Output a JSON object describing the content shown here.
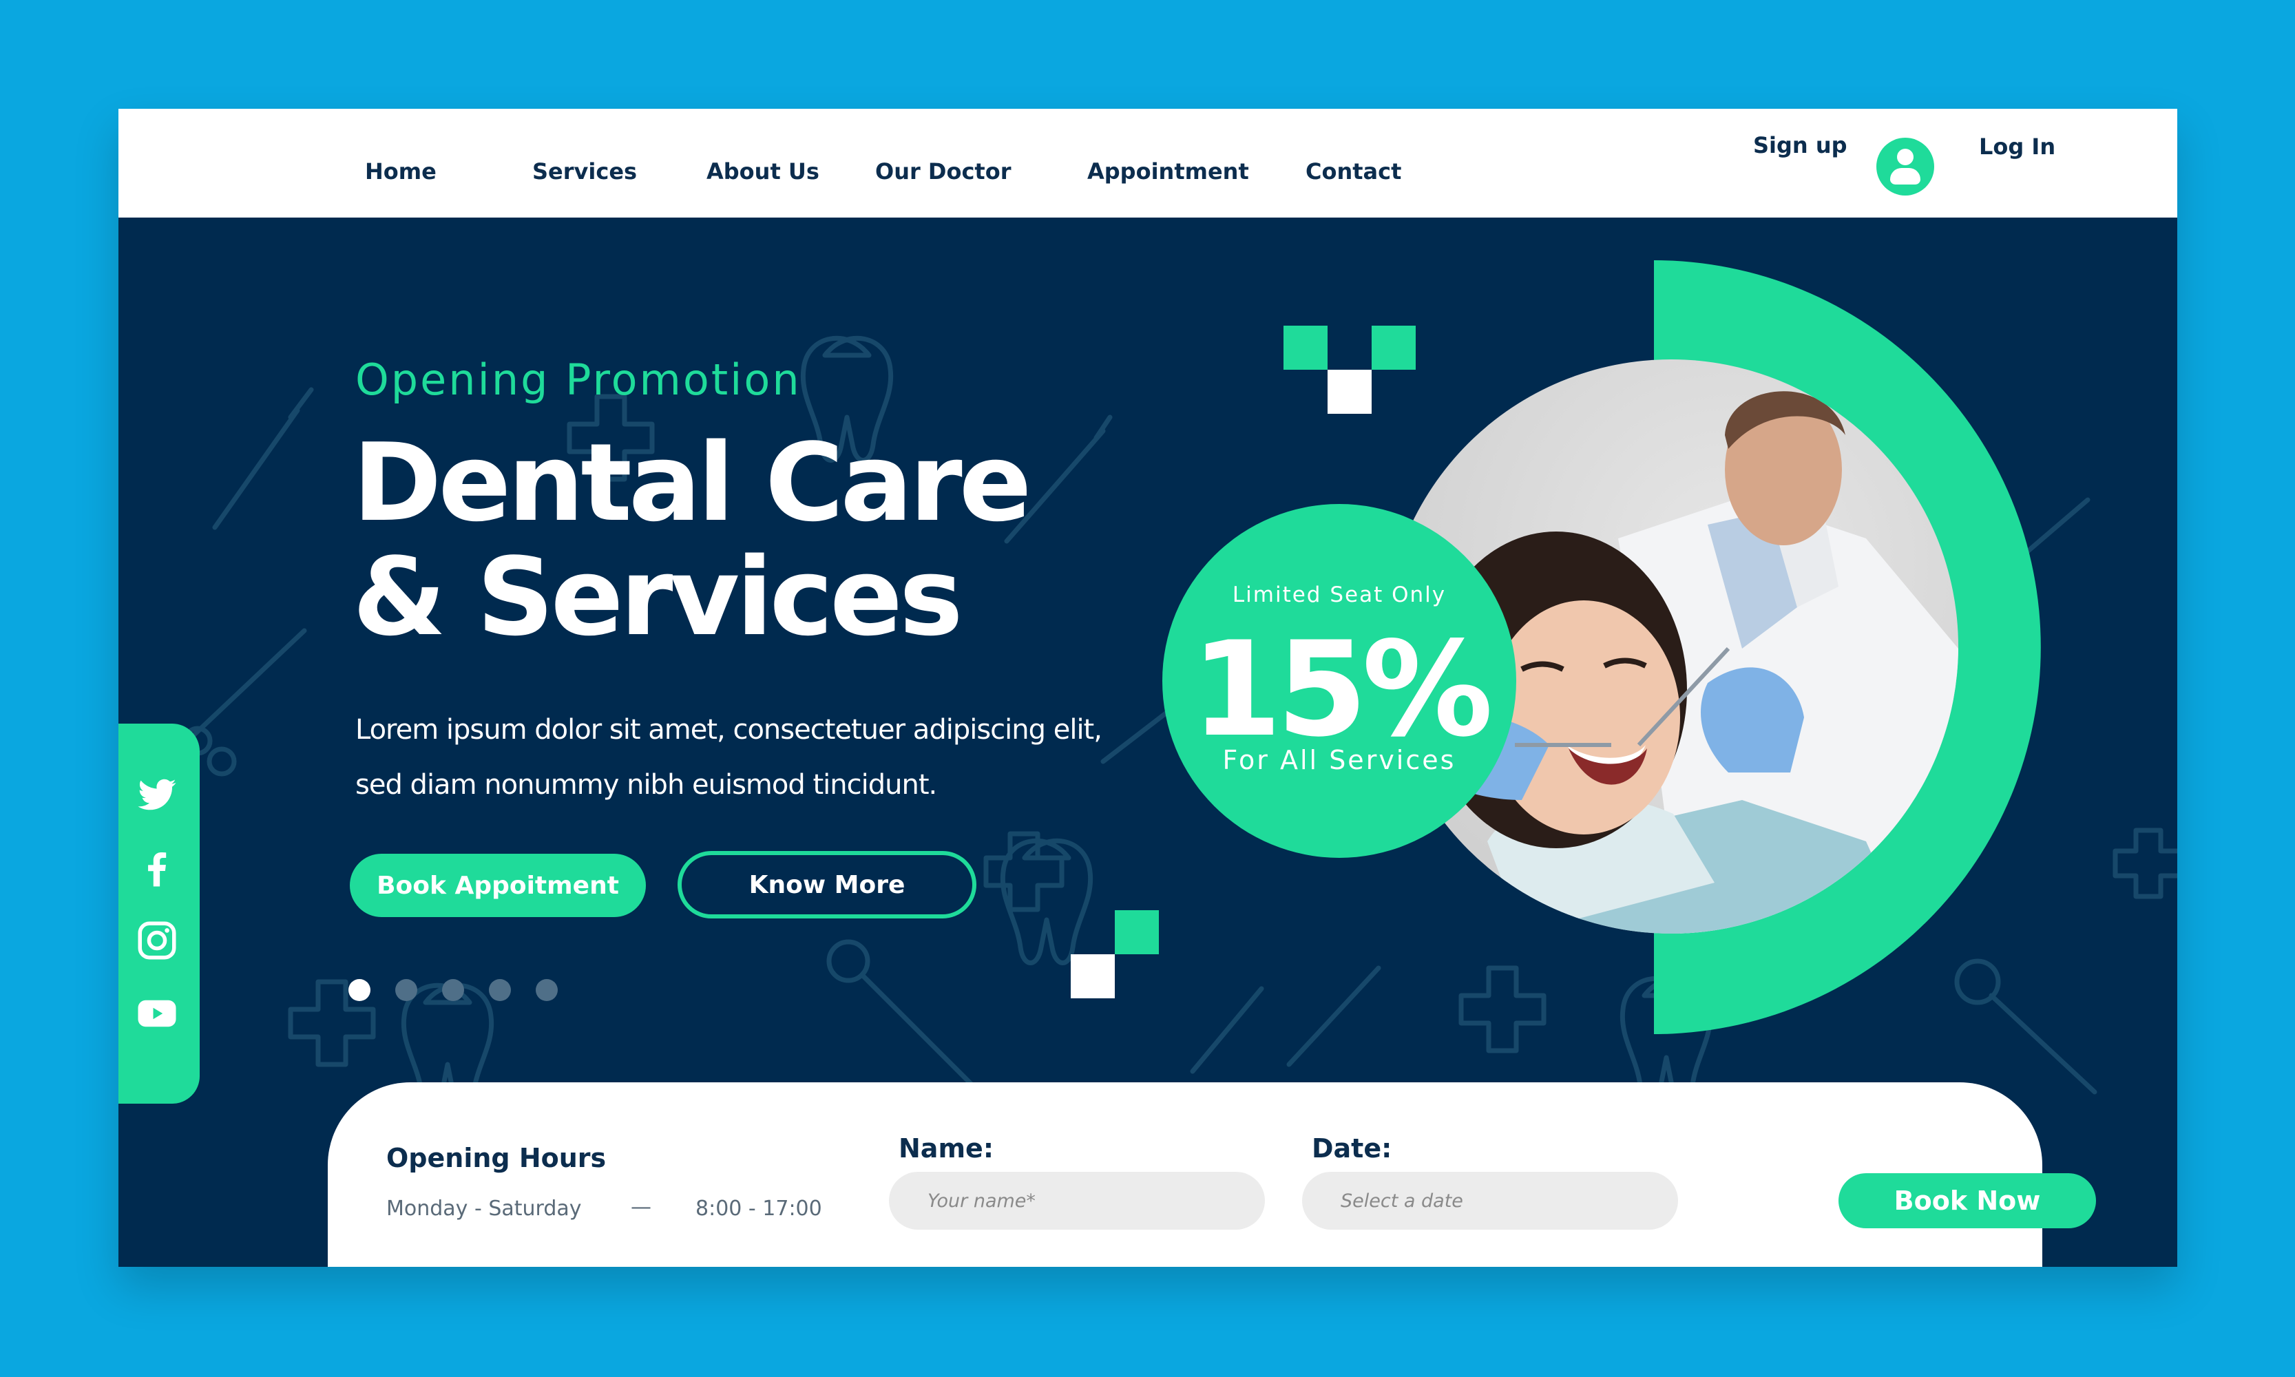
{
  "nav": {
    "links": [
      "Home",
      "Services",
      "About Us",
      "Our Doctor",
      "Appointment",
      "Contact"
    ],
    "signup": "Sign up",
    "login": "Log In",
    "user_icon": "user-icon"
  },
  "hero": {
    "promo": "Opening Promotion",
    "headline_line1": "Dental Care",
    "headline_line2": "& Services",
    "desc_line1": "Lorem ipsum dolor sit amet, consectetuer adipiscing elit,",
    "desc_line2": "sed diam nonummy nibh euismod tincidunt.",
    "book_button": "Book Appoitment",
    "know_button": "Know More",
    "slides": 5,
    "active_slide": 1
  },
  "discount": {
    "limited": "Limited Seat Only",
    "percent": "15%",
    "for_all": "For All Services"
  },
  "social": [
    "twitter-icon",
    "facebook-icon",
    "instagram-icon",
    "youtube-icon"
  ],
  "booking": {
    "hours_title": "Opening Hours",
    "days": "Monday - Saturday",
    "dash": "—",
    "time": "8:00 - 17:00",
    "name_label": "Name:",
    "name_placeholder": "Your name*",
    "date_label": "Date:",
    "date_placeholder": "Select a date",
    "book_now": "Book Now"
  },
  "colors": {
    "accent": "#1fdb9a",
    "navy": "#002a4f",
    "frame": "#0aa7e0",
    "text_dark": "#0c2d4e"
  }
}
